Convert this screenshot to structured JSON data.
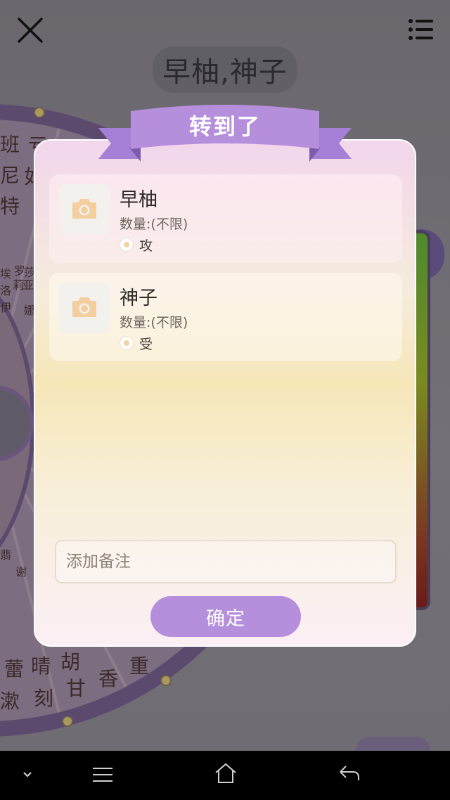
{
  "header": {
    "result_title": "早柚,神子"
  },
  "modal": {
    "ribbon_title": "转到了",
    "items": [
      {
        "name": "早柚",
        "quantity": "数量:(不限)",
        "tag": "攻"
      },
      {
        "name": "神子",
        "quantity": "数量:(不限)",
        "tag": "受"
      }
    ],
    "note_placeholder": "添加备注",
    "confirm_label": "确定"
  },
  "wheel": {
    "visible_chars": [
      "班",
      "尼",
      "特",
      "亏",
      "如",
      "埃",
      "罗",
      "莎",
      "洛",
      "莉",
      "亚",
      "伊",
      "娜",
      "漱",
      "蕾",
      "刻",
      "甘",
      "香",
      "重",
      "胡",
      "晴",
      "翡",
      "谢"
    ]
  },
  "icons": {
    "close": "close-icon",
    "menu": "list-menu-icon",
    "photo": "camera-icon",
    "nav_down": "chevron-down-icon",
    "nav_menu": "hamburger-icon",
    "nav_home": "home-icon",
    "nav_back": "back-icon"
  },
  "colors": {
    "ribbon": "#b58fdc",
    "confirm_button": "#b58fdc",
    "camera_icon": "#f3cfa0"
  }
}
